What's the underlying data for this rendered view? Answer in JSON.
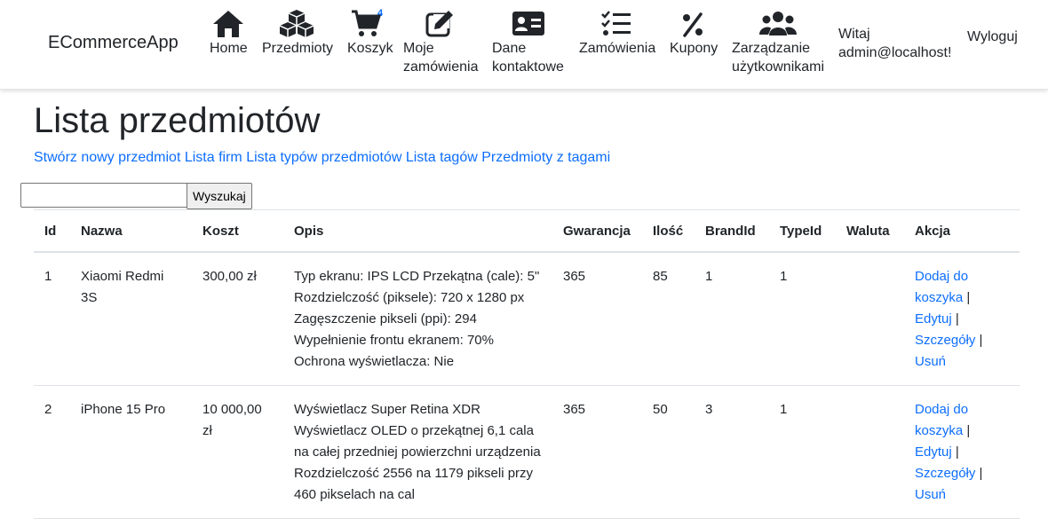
{
  "navbar": {
    "brand": "ECommerceApp",
    "items": [
      {
        "label": "Home",
        "icon": "home-icon"
      },
      {
        "label": "Przedmioty",
        "icon": "cubes-icon"
      },
      {
        "label": "Koszyk",
        "icon": "cart-icon",
        "badge": "4"
      },
      {
        "label_line1": "Moje",
        "label_line2": "zamówienia",
        "icon": "edit-icon"
      },
      {
        "label_line1": "Dane",
        "label_line2": "kontaktowe",
        "icon": "contact-card-icon"
      },
      {
        "label": "Zamówienia",
        "icon": "list-check-icon"
      },
      {
        "label": "Kupony",
        "icon": "percent-icon"
      },
      {
        "label_line1": "Zarządzanie",
        "label_line2": "użytkownikami",
        "icon": "users-icon"
      }
    ],
    "greeting_line1": "Witaj",
    "greeting_line2": "admin@localhost!",
    "logout": "Wyloguj"
  },
  "page": {
    "title": "Lista przedmiotów",
    "links": [
      "Stwórz nowy przedmiot",
      "Lista firm",
      "Lista typów przedmiotów",
      "Lista tagów",
      "Przedmioty z tagami"
    ]
  },
  "search": {
    "value": "",
    "button": "Wyszukaj"
  },
  "table": {
    "headers": [
      "Id",
      "Nazwa",
      "Koszt",
      "Opis",
      "Gwarancja",
      "Ilość",
      "BrandId",
      "TypeId",
      "Waluta",
      "Akcja"
    ],
    "actions": [
      "Dodaj do koszyka",
      "Edytuj",
      "Szczegóły",
      "Usuń"
    ],
    "rows": [
      {
        "id": "1",
        "name": "Xiaomi Redmi 3S",
        "cost": "300,00 zł",
        "desc": "Typ ekranu: IPS LCD Przekątna (cale): 5\" Rozdzielczość (piksele): 720 x 1280 px Zagęszczenie pikseli (ppi): 294 Wypełnienie frontu ekranem: 70% Ochrona wyświetlacza: Nie",
        "warranty": "365",
        "qty": "85",
        "brand": "1",
        "type": "1",
        "currency": ""
      },
      {
        "id": "2",
        "name": "iPhone 15 Pro",
        "cost": "10 000,00 zł",
        "desc": "Wyświetlacz Super Retina XDR Wyświetlacz OLED o przekątnej 6,1 cala na całej przedniej powierzchni urządzenia Rozdzielczość 2556 na 1179 pikseli przy 460 pikselach na cal",
        "warranty": "365",
        "qty": "50",
        "brand": "3",
        "type": "1",
        "currency": ""
      }
    ]
  }
}
